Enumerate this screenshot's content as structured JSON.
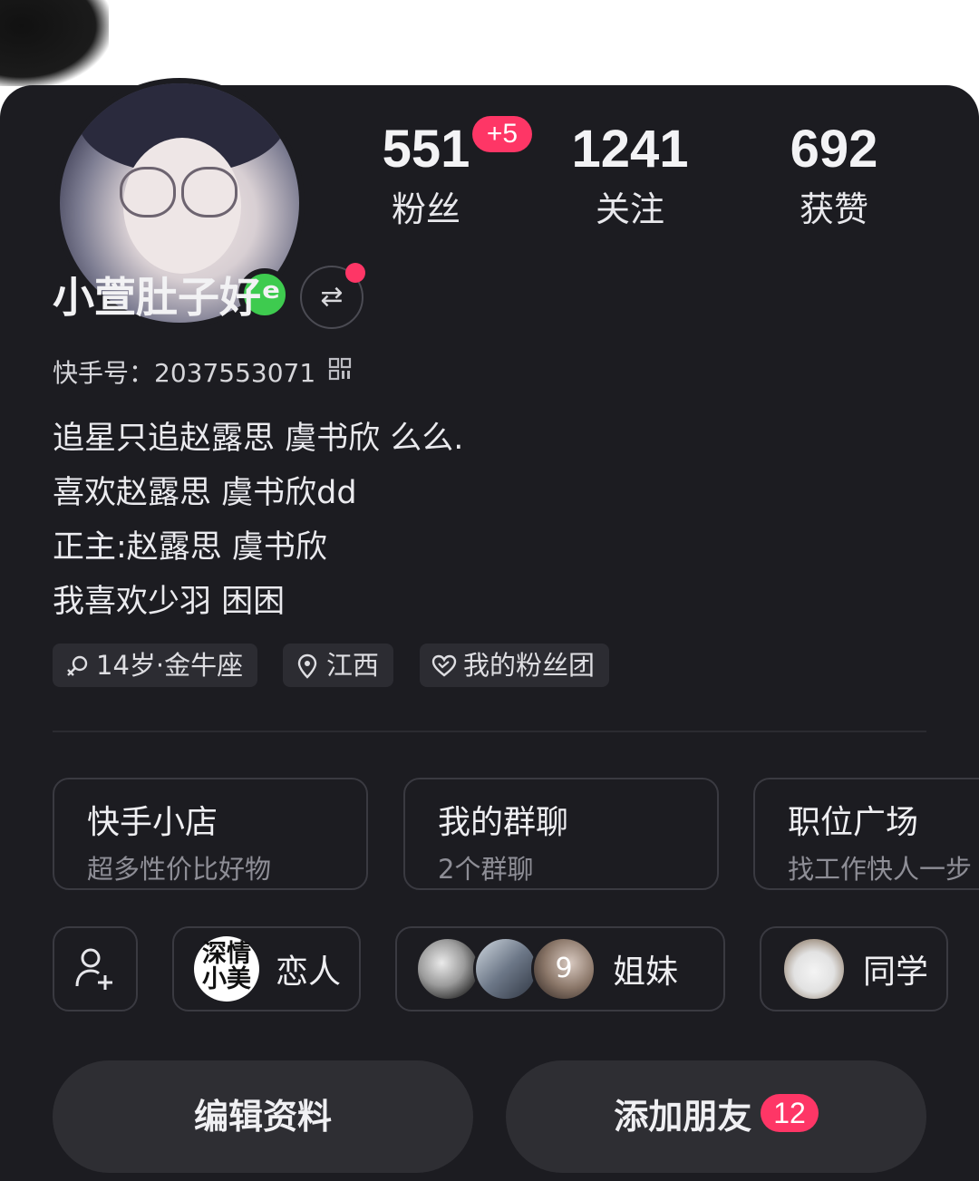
{
  "stats": {
    "fans_count": "551",
    "fans_delta": "+5",
    "fans_label": "粉丝",
    "following_count": "1241",
    "following_label": "关注",
    "likes_count": "692",
    "likes_label": "获赞"
  },
  "profile": {
    "username": "小萱肚子好ᵉ",
    "kuaishou_id": "快手号：2037553071",
    "bio": [
      "追星只追赵露思 虞书欣 么么.",
      "喜欢赵露思 虞书欣dd",
      "正主:赵露思 虞书欣",
      "我喜欢少羽 困困"
    ],
    "online_color": "#3ecb4f"
  },
  "tags": [
    {
      "label": "14岁·金牛座",
      "icon": "female-icon"
    },
    {
      "label": "江西",
      "icon": "location-pin-icon"
    },
    {
      "label": "我的粉丝团",
      "icon": "heart-icon"
    }
  ],
  "features": [
    {
      "title": "快手小店",
      "subtitle": "超多性价比好物"
    },
    {
      "title": "我的群聊",
      "subtitle": "2个群聊"
    },
    {
      "title": "职位广场",
      "subtitle": "找工作快人一步"
    }
  ],
  "relations": {
    "lover_avatar_text": "深情小美",
    "lover_label": "恋人",
    "sister_avatar_text": "9",
    "sisters_label": "姐妹",
    "classmate_label": "同学"
  },
  "actions": {
    "edit_label": "编辑资料",
    "add_friend_label": "添加朋友",
    "add_friend_count": "12"
  },
  "colors": {
    "accent": "#fe3666",
    "background": "#1c1c21"
  }
}
